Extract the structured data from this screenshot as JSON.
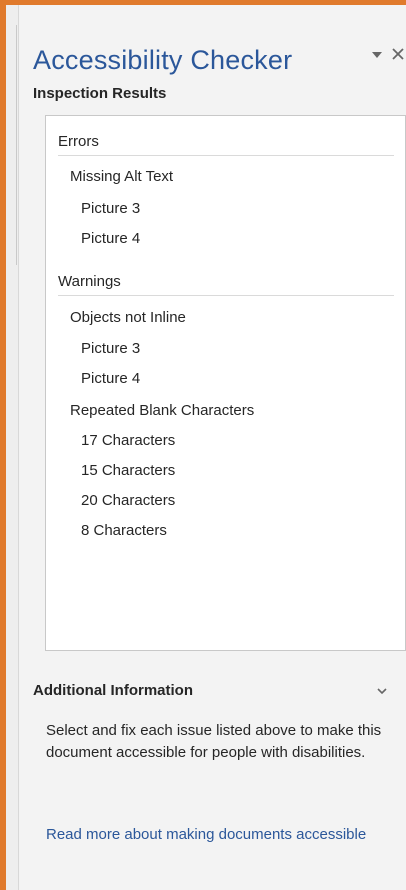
{
  "pane": {
    "title": "Accessibility Checker",
    "menu_icon": "chevron-down-icon",
    "close_icon": "close-icon"
  },
  "inspection": {
    "label": "Inspection Results",
    "errors": {
      "header": "Errors",
      "categories": [
        {
          "label": "Missing Alt Text",
          "items": [
            "Picture 3",
            "Picture 4"
          ]
        }
      ]
    },
    "warnings": {
      "header": "Warnings",
      "categories": [
        {
          "label": "Objects not Inline",
          "items": [
            "Picture 3",
            "Picture 4"
          ]
        },
        {
          "label": "Repeated Blank Characters",
          "items": [
            "17 Characters",
            "15 Characters",
            "20 Characters",
            "8 Characters"
          ]
        }
      ]
    }
  },
  "additional_info": {
    "header": "Additional Information",
    "body": "Select and fix each issue listed above to make this document accessible for people with disabilities.",
    "link": "Read more about making documents accessible"
  },
  "colors": {
    "accent": "#e07a2c",
    "title": "#2b579a",
    "link": "#2b579a",
    "text": "#262626"
  }
}
